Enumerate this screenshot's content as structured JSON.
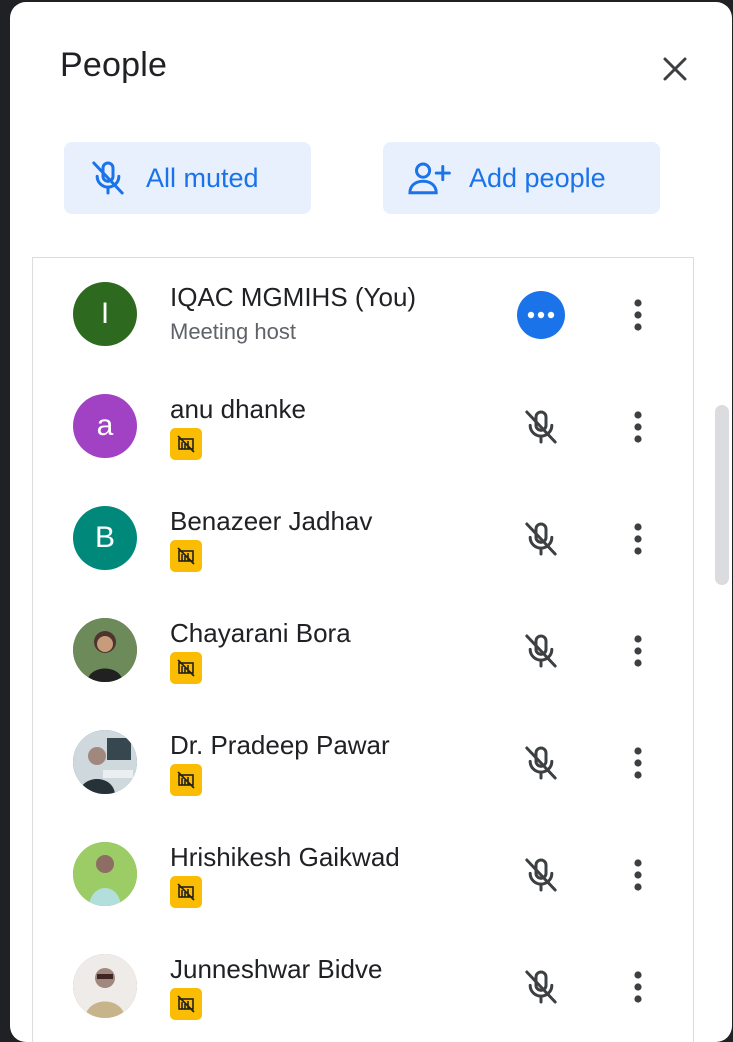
{
  "panel": {
    "title": "People"
  },
  "actions": {
    "all_muted_label": "All muted",
    "add_people_label": "Add people"
  },
  "participants": [
    {
      "name": "IQAC MGMIHS (You)",
      "subtitle": "Meeting host",
      "avatar_letter": "I",
      "avatar_color": "#2d6a1f",
      "status": "more",
      "badge": false
    },
    {
      "name": "anu dhanke",
      "subtitle": "",
      "avatar_letter": "a",
      "avatar_color": "#a142c4",
      "status": "muted",
      "badge": true
    },
    {
      "name": "Benazeer Jadhav",
      "subtitle": "",
      "avatar_letter": "B",
      "avatar_color": "#00897b",
      "status": "muted",
      "badge": true
    },
    {
      "name": "Chayarani Bora",
      "subtitle": "",
      "avatar_letter": "",
      "avatar_color": "#8d6e63",
      "status": "muted",
      "badge": true
    },
    {
      "name": "Dr. Pradeep Pawar",
      "subtitle": "",
      "avatar_letter": "",
      "avatar_color": "#546e7a",
      "status": "muted",
      "badge": true
    },
    {
      "name": "Hrishikesh Gaikwad",
      "subtitle": "",
      "avatar_letter": "",
      "avatar_color": "#7cb342",
      "status": "muted",
      "badge": true
    },
    {
      "name": "Junneshwar Bidve",
      "subtitle": "",
      "avatar_letter": "",
      "avatar_color": "#a1887f",
      "status": "muted",
      "badge": true
    }
  ],
  "icons": {
    "close": "close-icon",
    "mic_off": "mic-off-icon",
    "add_person": "person-add-icon",
    "more": "more-horiz-icon",
    "kebab": "more-vert-icon",
    "badge": "presentation-off-icon"
  },
  "colors": {
    "accent": "#1a73e8",
    "pill_bg": "#e8f0fe",
    "badge": "#fbbc04"
  }
}
